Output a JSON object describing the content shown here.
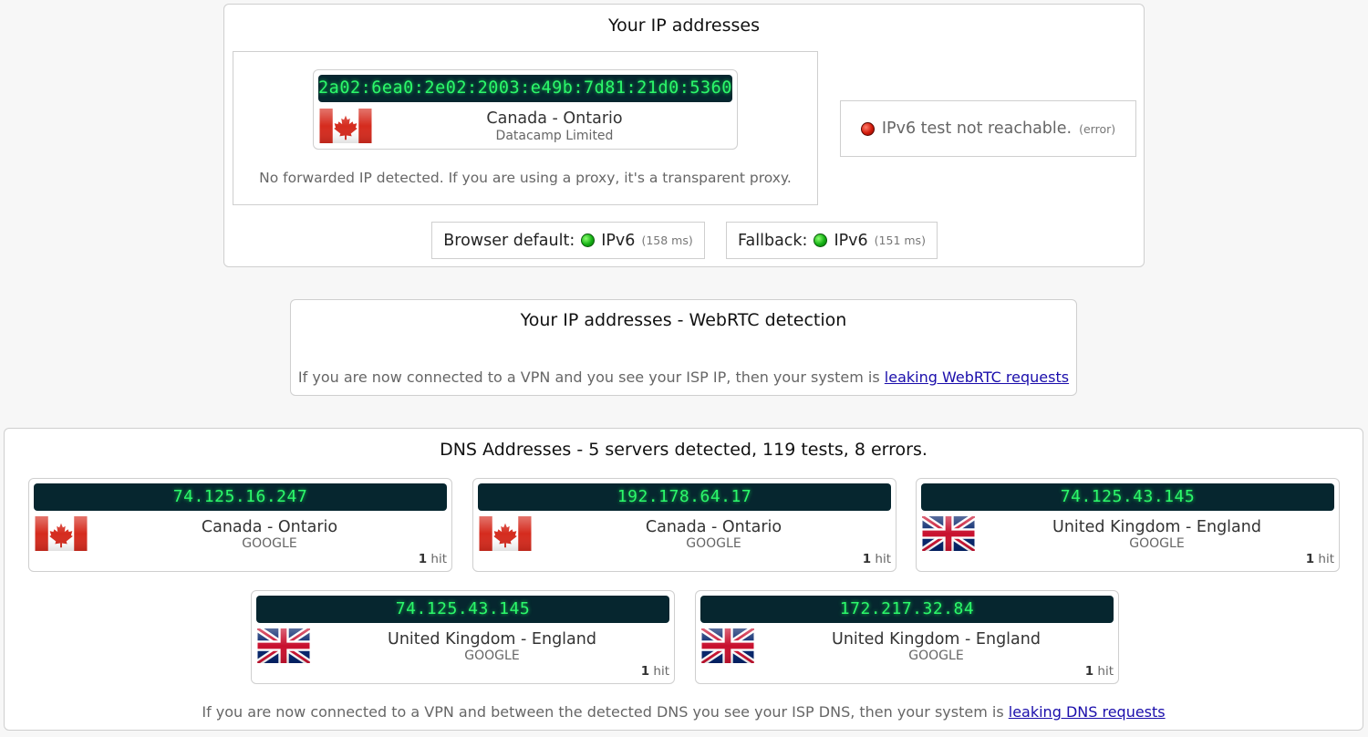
{
  "ip_section": {
    "title": "Your IP addresses",
    "address": "2a02:6ea0:2e02:2003:e49b:7d81:21d0:5360",
    "location": "Canada - Ontario",
    "isp": "Datacamp Limited",
    "forwarded_note": "No forwarded IP detected. If you are using a proxy, it's a transparent proxy.",
    "ipv6_test": {
      "text": "IPv6 test not reachable.",
      "status": "(error)"
    },
    "browser_default": {
      "label": "Browser default:",
      "protocol": "IPv6",
      "latency": "(158 ms)"
    },
    "fallback": {
      "label": "Fallback:",
      "protocol": "IPv6",
      "latency": "(151 ms)"
    }
  },
  "webrtc_section": {
    "title": "Your IP addresses - WebRTC detection",
    "note": "If you are now connected to a VPN and you see your ISP IP, then your system is",
    "link": "leaking WebRTC requests"
  },
  "dns_section": {
    "title": "DNS Addresses - 5 servers detected, 119 tests, 8 errors.",
    "servers": [
      {
        "ip": "74.125.16.247",
        "location": "Canada - Ontario",
        "isp": "GOOGLE",
        "hits": "1",
        "hit_label": "hit",
        "flag": "canada-flag"
      },
      {
        "ip": "192.178.64.17",
        "location": "Canada - Ontario",
        "isp": "GOOGLE",
        "hits": "1",
        "hit_label": "hit",
        "flag": "canada-flag"
      },
      {
        "ip": "74.125.43.145",
        "location": "United Kingdom - England",
        "isp": "GOOGLE",
        "hits": "1",
        "hit_label": "hit",
        "flag": "uk-flag"
      },
      {
        "ip": "74.125.43.145",
        "location": "United Kingdom - England",
        "isp": "GOOGLE",
        "hits": "1",
        "hit_label": "hit",
        "flag": "uk-flag"
      },
      {
        "ip": "172.217.32.84",
        "location": "United Kingdom - England",
        "isp": "GOOGLE",
        "hits": "1",
        "hit_label": "hit",
        "flag": "uk-flag"
      }
    ],
    "note": "If you are now connected to a VPN and between the detected DNS you see your ISP DNS, then your system is",
    "link": "leaking DNS requests"
  },
  "colors": {
    "led_background": "#06262f",
    "led_text": "#2cf86b",
    "status_ok": "#15b015",
    "status_error": "#d21a0a",
    "link": "#1a0dab"
  }
}
